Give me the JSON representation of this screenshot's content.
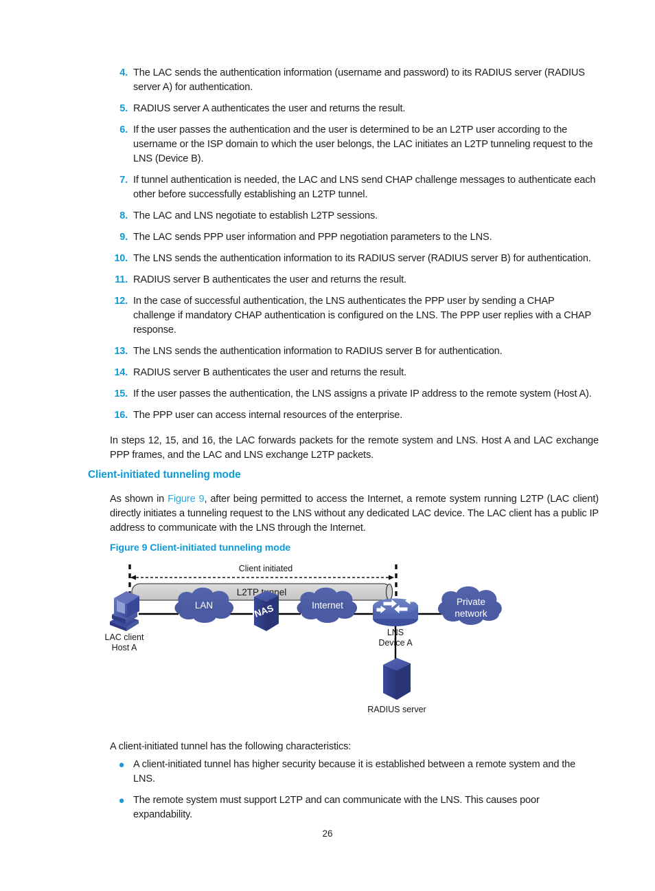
{
  "document": {
    "page_number": "26"
  },
  "numbered_steps": [
    {
      "marker": "4.",
      "text": "The LAC sends the authentication information (username and password) to its RADIUS server (RADIUS server A) for authentication."
    },
    {
      "marker": "5.",
      "text": "RADIUS server A authenticates the user and returns the result."
    },
    {
      "marker": "6.",
      "text": "If the user passes the authentication and the user is determined to be an L2TP user according to the username or the ISP domain to which the user belongs, the LAC initiates an L2TP tunneling request to the LNS (Device B)."
    },
    {
      "marker": "7.",
      "text": "If tunnel authentication is needed, the LAC and LNS send CHAP challenge messages to authenticate each other before successfully establishing an L2TP tunnel."
    },
    {
      "marker": "8.",
      "text": "The LAC and LNS negotiate to establish L2TP sessions."
    },
    {
      "marker": "9.",
      "text": "The LAC sends PPP user information and PPP negotiation parameters to the LNS."
    },
    {
      "marker": "10.",
      "text": "The LNS sends the authentication information to its RADIUS server (RADIUS server B) for authentication."
    },
    {
      "marker": "11.",
      "text": "RADIUS server B authenticates the user and returns the result."
    },
    {
      "marker": "12.",
      "text": "In the case of successful authentication, the LNS authenticates the PPP user by sending a CHAP challenge if mandatory CHAP authentication is configured on the LNS. The PPP user replies with a CHAP response."
    },
    {
      "marker": "13.",
      "text": "The LNS sends the authentication information to RADIUS server B for authentication."
    },
    {
      "marker": "14.",
      "text": "RADIUS server B authenticates the user and returns the result."
    },
    {
      "marker": "15.",
      "text": "If the user passes the authentication, the LNS assigns a private IP address to the remote system (Host A)."
    },
    {
      "marker": "16.",
      "text": "The PPP user can access internal resources of the enterprise."
    }
  ],
  "paragraph_steps": "In steps 12, 15, and 16, the LAC forwards packets for the remote system and LNS. Host A and LAC exchange PPP frames, and the LAC and LNS exchange L2TP packets.",
  "section": {
    "heading": "Client-initiated tunneling mode",
    "intro_before_link": "As shown in ",
    "intro_link": "Figure 9",
    "intro_after_link": ", after being permitted to access the Internet, a remote system running L2TP (LAC client) directly initiates a tunneling request to the LNS without any dedicated LAC device. The LAC client has a public IP address to communicate with the LNS through the Internet.",
    "figure_caption": "Figure 9 Client-initiated tunneling mode"
  },
  "figure": {
    "top_annotation": "Client initiated",
    "tunnel_label": "L2TP tunnel",
    "nodes": {
      "lac_client_line1": "LAC client",
      "lac_client_line2": "Host A",
      "lan": "LAN",
      "nas": "NAS",
      "internet": "Internet",
      "lns_line1": "LNS",
      "lns_line2": "Device A",
      "private_line1": "Private",
      "private_line2": "network",
      "radius": "RADIUS server"
    },
    "colors": {
      "cloud": "#4c5da6",
      "device_dark": "#2b3b87",
      "device_mid": "#4a5db0",
      "tunnel_fill": "#d4d4d4",
      "router_body": "#5b72bb",
      "link": "#000000"
    }
  },
  "characteristics": {
    "intro": "A client-initiated tunnel has the following characteristics:",
    "bullets": [
      {
        "marker": "●",
        "text": "A client-initiated tunnel has higher security because it is established between a remote system and the LNS."
      },
      {
        "marker": "●",
        "text": "The remote system must support L2TP and can communicate with the LNS. This causes poor expandability."
      }
    ]
  },
  "theme": {
    "accent_blue": "#0d9ad6",
    "link_blue": "#29a9e1",
    "body_text": "#1c1c1c"
  }
}
